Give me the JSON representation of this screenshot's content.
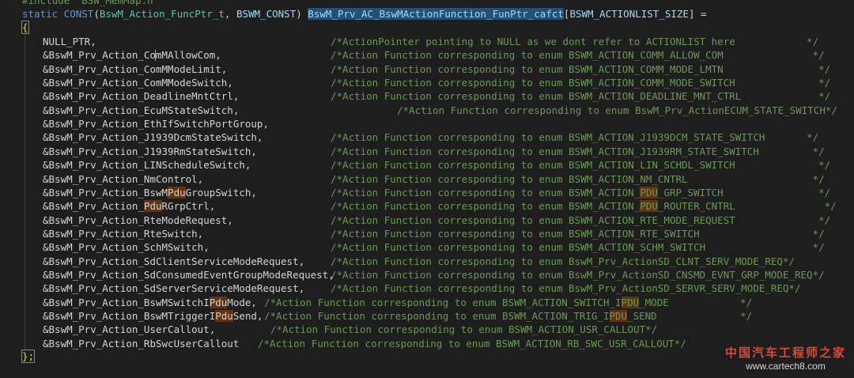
{
  "header_include": "#include \"BSW_MemMap.h\"",
  "decl": {
    "static": "static",
    "const": "CONST",
    "type": "BswM_Action_FuncPtr_t",
    "sep": ", ",
    "const_arg": "BSWM_CONST",
    "array_name": "BswM_Prv_AC_BswMActionFunction_FunPtr_cafct",
    "size": "BSWM_ACTIONLIST_SIZE",
    "assign": "] ="
  },
  "open_brace": "{",
  "close_brace": "};",
  "rows": [
    {
      "code": "NULL_PTR,",
      "comment": "/*ActionPointer pointing to NULL as we dont refer to ACTIONLIST here            */",
      "col": 418
    },
    {
      "code": "&BswM_Prv_Action_ComMAllowCom,",
      "comment": "/*Action Function corresponding to enum BSWM_ACTION_COMM_ALLOW_COM               */",
      "col": 418
    },
    {
      "code": "&BswM_Prv_Action_ComMModeLimit,",
      "comment": "/*Action Function corresponding to enum BSWM_ACTION_COMM_MODE_LMTN                */",
      "col": 418
    },
    {
      "code": "&BswM_Prv_Action_ComMModeSwitch,",
      "comment": "/*Action Function corresponding to enum BSWM_ACTION_COMM_MODE_SWITCH              */",
      "col": 418
    },
    {
      "code": "&BswM_Prv_Action_DeadlineMntCtrl,",
      "comment": "/*Action Function corresponding to enum BSWM_ACTION_DEADLINE_MNT_CTRL             */",
      "col": 418
    },
    {
      "code": "&BswM_Prv_Action_EcuMStateSwitch,",
      "comment": "/*Action Function corresponding to enum BswM_Prv_ActionECUM_STATE_SWITCH*/",
      "col": 502
    },
    {
      "code": "&BswM_Prv_Action_EthIfSwitchPortGroup,",
      "comment": "",
      "col": 418
    },
    {
      "code": "&BswM_Prv_Action_J1939DcmStateSwitch,",
      "comment": "/*Action Function corresponding to enum BSWM_ACTION_J1939DCM_STATE_SWITCH       */",
      "col": 418
    },
    {
      "code": "&BswM_Prv_Action_J1939RmStateSwitch,",
      "comment": "/*Action Function corresponding to enum BSWM_ACTION_J1939RM_STATE_SWITCH         */",
      "col": 418
    },
    {
      "code": "&BswM_Prv_Action_LINScheduleSwitch,",
      "comment": "/*Action Function corresponding to enum BSWM_ACTION_LIN_SCHDL_SWITCH              */",
      "col": 418
    },
    {
      "code": "&BswM_Prv_Action_NmControl,",
      "comment": "/*Action Function corresponding to enum BSWM_ACTION_NM_CNTRL                     */",
      "col": 418
    },
    {
      "code": "&BswM_Prv_Action_BswMPduGroupSwitch,",
      "comment": "/*Action Function corresponding to enum BSWM_ACTION_PDU_GRP_SWITCH                */",
      "col": 418
    },
    {
      "code": "&BswM_Prv_Action_PduRGrpCtrl,",
      "comment": "/*Action Function corresponding to enum BSWM_ACTION_PDU_ROUTER_CNTRL               */",
      "col": 418
    },
    {
      "code": "&BswM_Prv_Action_RteModeRequest,",
      "comment": "/*Action Function corresponding to enum BSWM_ACTION_RTE_MODE_REQUEST              */",
      "col": 418
    },
    {
      "code": "&BswM_Prv_Action_RteSwitch,",
      "comment": "/*Action Function corresponding to enum BSWM_ACTION_RTE_SWITCH                   */",
      "col": 418
    },
    {
      "code": "&BswM_Prv_Action_SchMSwitch,",
      "comment": "/*Action Function corresponding to enum BSWM_ACTION_SCHM_SWITCH                  */",
      "col": 418
    },
    {
      "code": "&BswM_Prv_Action_SdClientServiceModeRequest,",
      "comment": "/*Action Function corresponding to enum BswM_Prv_ActionSD_CLNT_SERV_MODE_REQ*/",
      "col": 418
    },
    {
      "code": "&BswM_Prv_Action_SdConsumedEventGroupModeRequest,",
      "comment": "/*Action Function corresponding to enum BswM_Prv_ActionSD_CNSMD_EVNT_GRP_MODE_REQ*/",
      "col": 418
    },
    {
      "code": "&BswM_Prv_Action_SdServerServiceModeRequest,",
      "comment": "/*Action Function corresponding to enum BswM_Prv_ActionSD_SERVR_SERV_MODE_REQ*/",
      "col": 418
    },
    {
      "code": "&BswM_Prv_Action_BswMSwitchIPduMode,",
      "comment": "/*Action Function corresponding to enum BSWM_ACTION_SWITCH_IPDU_MODE            */",
      "col": 334
    },
    {
      "code": "&BswM_Prv_Action_BswMTriggerIPduSend,",
      "comment": "/*Action Function corresponding to enum BSWM_ACTION_TRIG_IPDU_SEND              */",
      "col": 334
    },
    {
      "code": "&BswM_Prv_Action_UserCallout,",
      "comment": "/*Action Function corresponding to enum BSWM_ACTION_USR_CALLOUT*/",
      "col": 342
    },
    {
      "code": "&BswM_Prv_Action_RbSwcUserCallout",
      "comment": "/*Action Function corresponding to enum BSWM_ACTION_RB_SWC_USR_CALLOUT*/",
      "col": 326
    }
  ],
  "watermark": {
    "cn": "中国汽车工程师之家",
    "url": "www.cartech8.com"
  }
}
